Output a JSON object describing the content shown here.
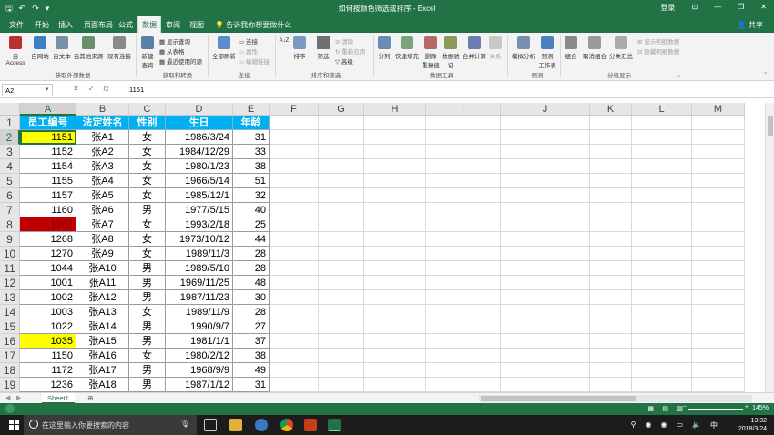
{
  "window": {
    "title": "如何按颜色筛选或排序 - Excel",
    "login": "登录",
    "controls": [
      "—",
      "❐",
      "✕"
    ]
  },
  "tabs": [
    "文件",
    "开始",
    "插入",
    "页面布局",
    "公式",
    "数据",
    "审阅",
    "视图"
  ],
  "tell_me": "告诉我你想要做什么",
  "share": "共享",
  "ribbon": {
    "get_external": [
      "自 Access",
      "自网站",
      "自文本",
      "自其他来源",
      "现有连接"
    ],
    "get_external_label": "获取外部数据",
    "new_query": "新建\n查询",
    "query_small": [
      "显示查询",
      "从表格",
      "最近使用的源"
    ],
    "transform_label": "获取和转换",
    "refresh_all": "全部刷新",
    "conn_small": [
      "连接",
      "属性",
      "编辑链接"
    ],
    "conn_label": "连接",
    "sort_az": "A↓Z",
    "sort": "排序",
    "filter": "筛选",
    "filter_small": [
      "清除",
      "重新应用",
      "高级"
    ],
    "sort_filter_label": "排序和筛选",
    "tools": [
      "分列",
      "快速填充",
      "删除\n重复值",
      "数据验\n证",
      "合并计算",
      "关系"
    ],
    "tools_label": "数据工具",
    "forecast": [
      "模拟分析",
      "预测\n工作表"
    ],
    "forecast_label": "预测",
    "outline": [
      "组合",
      "取消组合",
      "分类汇总"
    ],
    "outline_small": [
      "显示明细数据",
      "隐藏明细数据"
    ],
    "outline_label": "分级显示"
  },
  "formula_bar": {
    "name_box": "A2",
    "icons": [
      "✕",
      "✓",
      "fx"
    ],
    "value": "1151"
  },
  "columns": [
    "A",
    "B",
    "C",
    "D",
    "E",
    "F",
    "G",
    "H",
    "I",
    "J",
    "K",
    "L",
    "M"
  ],
  "rows": [
    "1",
    "2",
    "3",
    "4",
    "5",
    "6",
    "7",
    "8",
    "9",
    "10",
    "11",
    "12",
    "13",
    "14",
    "15",
    "16",
    "17",
    "18",
    "19"
  ],
  "table": {
    "headers": [
      "员工编号",
      "法定姓名",
      "性别",
      "生日",
      "年龄"
    ],
    "data": [
      [
        "1151",
        "张A1",
        "女",
        "1986/3/24",
        "31"
      ],
      [
        "1152",
        "张A2",
        "女",
        "1984/12/29",
        "33"
      ],
      [
        "1154",
        "张A3",
        "女",
        "1980/1/23",
        "38"
      ],
      [
        "1155",
        "张A4",
        "女",
        "1966/5/14",
        "51"
      ],
      [
        "1157",
        "张A5",
        "女",
        "1985/12/1",
        "32"
      ],
      [
        "1160",
        "张A6",
        "男",
        "1977/5/15",
        "40"
      ],
      [
        "1267",
        "张A7",
        "女",
        "1993/2/18",
        "25"
      ],
      [
        "1268",
        "张A8",
        "女",
        "1973/10/12",
        "44"
      ],
      [
        "1270",
        "张A9",
        "女",
        "1989/11/3",
        "28"
      ],
      [
        "1044",
        "张A10",
        "男",
        "1989/5/10",
        "28"
      ],
      [
        "1001",
        "张A11",
        "男",
        "1969/11/25",
        "48"
      ],
      [
        "1002",
        "张A12",
        "男",
        "1987/11/23",
        "30"
      ],
      [
        "1003",
        "张A13",
        "女",
        "1989/11/9",
        "28"
      ],
      [
        "1022",
        "张A14",
        "男",
        "1990/9/7",
        "27"
      ],
      [
        "1035",
        "张A15",
        "男",
        "1981/1/1",
        "37"
      ],
      [
        "1150",
        "张A16",
        "女",
        "1980/2/12",
        "38"
      ],
      [
        "1172",
        "张A17",
        "男",
        "1968/9/9",
        "49"
      ],
      [
        "1236",
        "张A18",
        "男",
        "1987/1/12",
        "31"
      ]
    ],
    "fills": {
      "0": "yellow",
      "6": "red",
      "14": "yellow"
    }
  },
  "colors": {
    "excel_green": "#217346",
    "header_fill": "#00b0f0",
    "yellow": "#ffff00",
    "red": "#c00000"
  },
  "sheet": {
    "tab": "Sheet1",
    "add": "⊕"
  },
  "status": {
    "zoom": "145%",
    "zoom_controls": [
      "−",
      "+"
    ]
  },
  "taskbar": {
    "search_placeholder": "在这里输入你要搜索的内容",
    "time": "13:32",
    "date": "2018/3/24",
    "ime": "中"
  }
}
